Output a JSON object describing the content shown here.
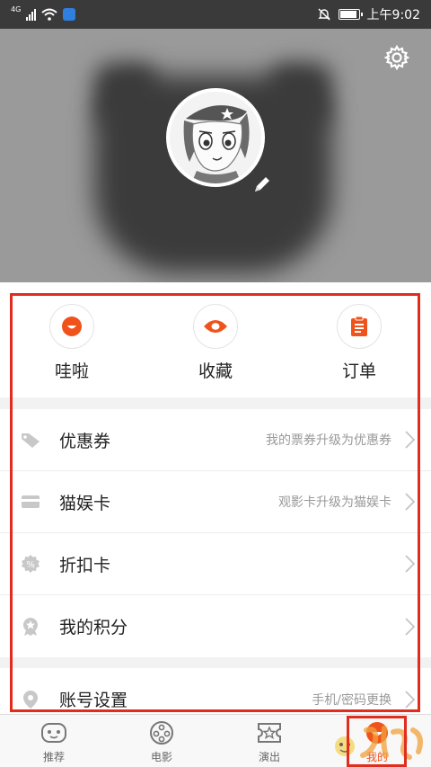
{
  "status_bar": {
    "network": "4G",
    "time": "上午9:02"
  },
  "header": {
    "settings_icon": "gear-icon",
    "edit_icon": "pencil-icon"
  },
  "quick_actions": [
    {
      "label": "哇啦",
      "icon": "wala-icon"
    },
    {
      "label": "收藏",
      "icon": "eye-icon"
    },
    {
      "label": "订单",
      "icon": "clipboard-icon"
    }
  ],
  "menu_group_1": [
    {
      "title": "优惠券",
      "hint": "我的票券升级为优惠券",
      "icon": "tag-icon"
    },
    {
      "title": "猫娱卡",
      "hint": "观影卡升级为猫娱卡",
      "icon": "card-icon"
    },
    {
      "title": "折扣卡",
      "hint": "",
      "icon": "discount-icon"
    },
    {
      "title": "我的积分",
      "hint": "",
      "icon": "points-icon"
    }
  ],
  "menu_group_2": [
    {
      "title": "账号设置",
      "hint": "手机/密码更换",
      "icon": "location-pin-icon"
    }
  ],
  "bottom_nav": [
    {
      "label": "推荐",
      "icon": "recommend-icon"
    },
    {
      "label": "电影",
      "icon": "film-reel-icon"
    },
    {
      "label": "演出",
      "icon": "ticket-star-icon"
    },
    {
      "label": "我的",
      "icon": "profile-icon",
      "active": true
    }
  ],
  "colors": {
    "accent": "#f0521c",
    "annotation": "#e12c1e",
    "header_bg": "#9a9a9a"
  }
}
